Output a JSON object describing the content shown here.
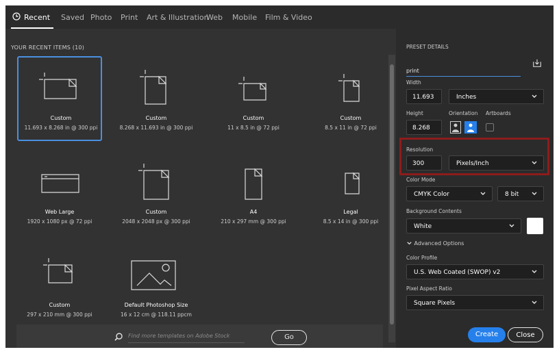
{
  "tabs": [
    {
      "label": "Recent",
      "active": true
    },
    {
      "label": "Saved"
    },
    {
      "label": "Photo"
    },
    {
      "label": "Print"
    },
    {
      "label": "Art & Illustration"
    },
    {
      "label": "Web"
    },
    {
      "label": "Mobile"
    },
    {
      "label": "Film & Video"
    }
  ],
  "recent": {
    "title": "YOUR RECENT ITEMS  (10)",
    "items": [
      {
        "name": "Custom",
        "dims": "11.693 x 8.268 in @ 300 ppi",
        "icon": "landscape-doc-icon",
        "selected": true
      },
      {
        "name": "Custom",
        "dims": "8.268 x 11.693 in @ 300 ppi",
        "icon": "portrait-doc-icon"
      },
      {
        "name": "Custom",
        "dims": "11 x 8.5 in @ 72 ppi",
        "icon": "landscape-doc-icon"
      },
      {
        "name": "Custom",
        "dims": "8.5 x 11 in @ 72 ppi",
        "icon": "portrait-doc-icon"
      },
      {
        "name": "Web Large",
        "dims": "1920 x 1080 px @ 72 ppi",
        "icon": "web-doc-icon"
      },
      {
        "name": "Custom",
        "dims": "2048 x 2048 px @ 300 ppi",
        "icon": "portrait-doc-icon"
      },
      {
        "name": "A4",
        "dims": "210 x 297 mm @ 300 ppi",
        "icon": "page-doc-icon"
      },
      {
        "name": "Legal",
        "dims": "8.5 x 14 in @ 300 ppi",
        "icon": "page-doc-icon"
      },
      {
        "name": "Custom",
        "dims": "297 x 210 mm @ 300 ppi",
        "icon": "landscape-doc-icon"
      },
      {
        "name": "Default Photoshop Size",
        "dims": "16 x 12 cm @ 118.11 ppcm",
        "icon": "image-doc-icon"
      }
    ]
  },
  "search": {
    "placeholder": "Find more templates on Adobe Stock",
    "go_label": "Go"
  },
  "preset": {
    "header": "PRESET DETAILS",
    "name_value": "print",
    "width_label": "Width",
    "width_value": "11.693",
    "width_unit": "Inches",
    "height_label": "Height",
    "height_value": "8.268",
    "orientation_label": "Orientation",
    "artboards_label": "Artboards",
    "resolution_label": "Resolution",
    "resolution_value": "300",
    "resolution_unit": "Pixels/Inch",
    "color_mode_label": "Color Mode",
    "color_mode_value": "CMYK Color",
    "bit_depth_value": "8 bit",
    "background_label": "Background Contents",
    "background_value": "White",
    "advanced_label": "Advanced Options",
    "color_profile_label": "Color Profile",
    "color_profile_value": "U.S. Web Coated (SWOP) v2",
    "pixel_aspect_label": "Pixel Aspect Ratio",
    "pixel_aspect_value": "Square Pixels"
  },
  "actions": {
    "create_label": "Create",
    "close_label": "Close"
  },
  "colors": {
    "accent": "#2680eb",
    "highlight_box": "#8e1c1c",
    "selected_border": "#4a90e2"
  }
}
